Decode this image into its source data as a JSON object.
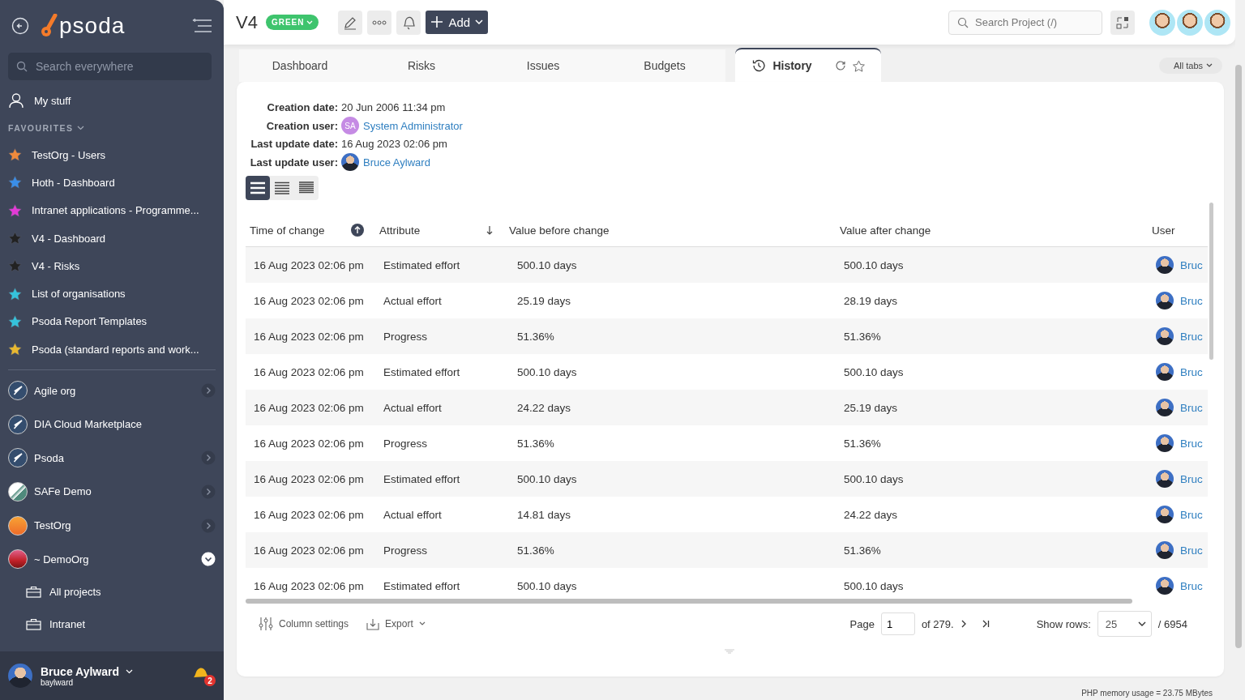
{
  "sidebar": {
    "logo": "psoda",
    "search": {
      "placeholder": "Search everywhere"
    },
    "my_stuff": "My stuff",
    "favourites_heading": "FAVOURITES",
    "favourites": [
      {
        "label": "TestOrg - Users",
        "color": "#f08a3c"
      },
      {
        "label": "Hoth - Dashboard",
        "color": "#3a8ee8"
      },
      {
        "label": "Intranet applications - Programme...",
        "color": "#e23ad6"
      },
      {
        "label": "V4 - Dashboard",
        "color": "#222222"
      },
      {
        "label": "V4 - Risks",
        "color": "#222222"
      },
      {
        "label": "List of organisations",
        "color": "#35c3dc"
      },
      {
        "label": "Psoda Report Templates",
        "color": "#35c3dc"
      },
      {
        "label": "Psoda (standard reports and work...",
        "color": "#e8b830"
      }
    ],
    "organisations": [
      {
        "name": "Agile org",
        "kind": "rocket",
        "expanded": false
      },
      {
        "name": "DIA Cloud Marketplace",
        "kind": "rocket"
      },
      {
        "name": "Psoda",
        "kind": "rocket",
        "expanded": false
      },
      {
        "name": "SAFe Demo",
        "kind": "stripes",
        "expanded": false
      },
      {
        "name": "TestOrg",
        "kind": "orange",
        "expanded": false
      },
      {
        "name": "~ DemoOrg",
        "kind": "sunset",
        "expanded": true
      }
    ],
    "org_children": [
      "All projects",
      "Intranet"
    ],
    "user": {
      "name": "Bruce Aylward",
      "username": "baylward",
      "notifications": "2"
    }
  },
  "header": {
    "title": "V4",
    "status": {
      "label": "GREEN",
      "color": "#3ec46d"
    },
    "add_button": "Add",
    "search": {
      "placeholder": "Search Project (/)"
    }
  },
  "tabs": [
    {
      "label": "Dashboard",
      "selected": false
    },
    {
      "label": "Risks",
      "selected": false
    },
    {
      "label": "Issues",
      "selected": false
    },
    {
      "label": "Budgets",
      "selected": false
    },
    {
      "label": "History",
      "selected": true
    }
  ],
  "all_tabs": "All tabs",
  "details": [
    {
      "label": "Creation date:",
      "value": "20 Jun 2006 11:34 pm",
      "kind": "text"
    },
    {
      "label": "Creation user:",
      "value": "System Administrator",
      "kind": "user",
      "initials": "SA"
    },
    {
      "label": "Last update date:",
      "value": "16 Aug 2023 02:06 pm",
      "kind": "text"
    },
    {
      "label": "Last update user:",
      "value": "Bruce Aylward",
      "kind": "user"
    }
  ],
  "density_options": [
    {
      "selected": true
    },
    {
      "selected": false
    },
    {
      "selected": false
    }
  ],
  "table": {
    "columns": [
      {
        "label": "Time of change",
        "sorted": true
      },
      {
        "label": "Attribute",
        "sorted": false
      },
      {
        "label": "Value before change"
      },
      {
        "label": "Value after change"
      },
      {
        "label": "User"
      }
    ],
    "rows": [
      [
        "16 Aug 2023 02:06 pm",
        "Estimated effort",
        "500.10 days",
        "500.10 days",
        "Bruc"
      ],
      [
        "16 Aug 2023 02:06 pm",
        "Actual effort",
        "25.19 days",
        "28.19 days",
        "Bruc"
      ],
      [
        "16 Aug 2023 02:06 pm",
        "Progress",
        "51.36%",
        "51.36%",
        "Bruc"
      ],
      [
        "16 Aug 2023 02:06 pm",
        "Estimated effort",
        "500.10 days",
        "500.10 days",
        "Bruc"
      ],
      [
        "16 Aug 2023 02:06 pm",
        "Actual effort",
        "24.22 days",
        "25.19 days",
        "Bruc"
      ],
      [
        "16 Aug 2023 02:06 pm",
        "Progress",
        "51.36%",
        "51.36%",
        "Bruc"
      ],
      [
        "16 Aug 2023 02:06 pm",
        "Estimated effort",
        "500.10 days",
        "500.10 days",
        "Bruc"
      ],
      [
        "16 Aug 2023 02:06 pm",
        "Actual effort",
        "14.81 days",
        "24.22 days",
        "Bruc"
      ],
      [
        "16 Aug 2023 02:06 pm",
        "Progress",
        "51.36%",
        "51.36%",
        "Bruc"
      ],
      [
        "16 Aug 2023 02:06 pm",
        "Estimated effort",
        "500.10 days",
        "500.10 days",
        "Bruc"
      ]
    ]
  },
  "footer": {
    "column_settings": "Column settings",
    "export": "Export",
    "page_label": "Page",
    "page": "1",
    "of_pages": "of 279.",
    "show_rows_label": "Show rows:",
    "rows_per_page": "25",
    "total": "/ 6954"
  },
  "memory_usage": "PHP memory usage = 23.75 MBytes"
}
